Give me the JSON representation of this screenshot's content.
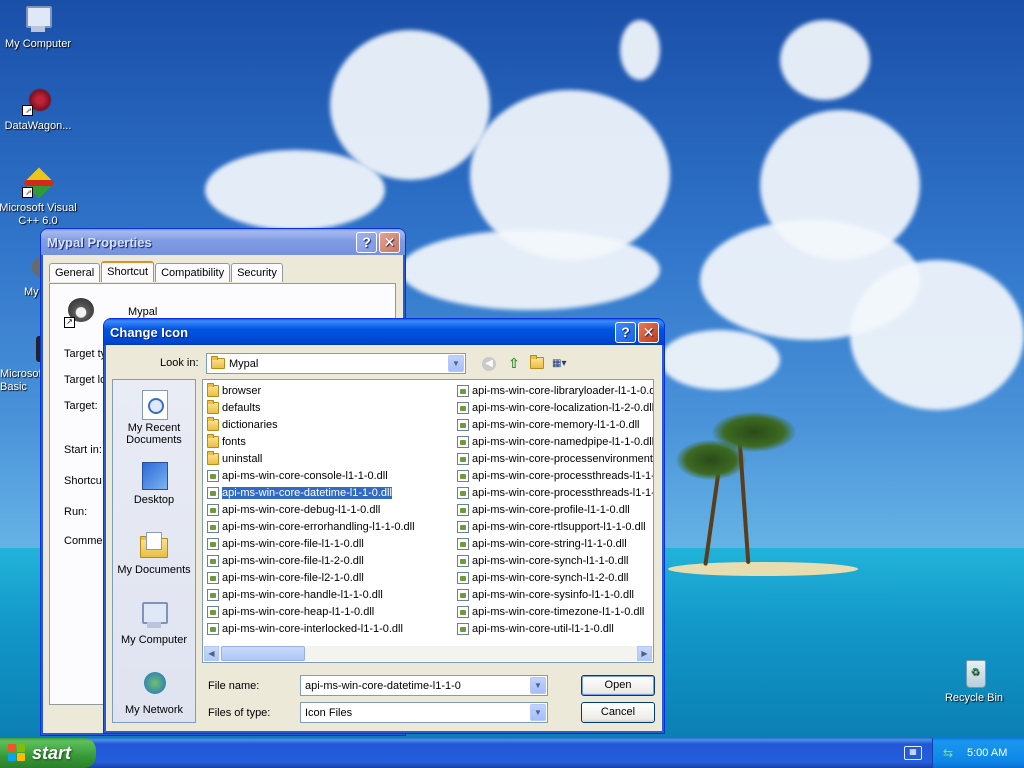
{
  "desktop": {
    "icons": [
      {
        "label": "My Computer"
      },
      {
        "label": "DataWagon..."
      },
      {
        "label": "Microsoft Visual C++ 6.0"
      },
      {
        "label": "My"
      },
      {
        "label": "Microsoft Basic"
      },
      {
        "label": "Recycle Bin"
      }
    ]
  },
  "props_window": {
    "title": "Mypal Properties",
    "tabs": [
      "General",
      "Shortcut",
      "Compatibility",
      "Security"
    ],
    "app_name": "Mypal",
    "labels": [
      "Target ty",
      "Target lo",
      "Target:",
      "Start in:",
      "Shortcu",
      "Run:",
      "Commer"
    ]
  },
  "change_icon": {
    "title": "Change Icon",
    "look_in_label": "Look in:",
    "look_in_value": "Mypal",
    "places": [
      "My Recent Documents",
      "Desktop",
      "My Documents",
      "My Computer",
      "My Network"
    ],
    "files_col1": [
      {
        "name": "browser",
        "type": "folder"
      },
      {
        "name": "defaults",
        "type": "folder"
      },
      {
        "name": "dictionaries",
        "type": "folder"
      },
      {
        "name": "fonts",
        "type": "folder"
      },
      {
        "name": "uninstall",
        "type": "folder"
      },
      {
        "name": "api-ms-win-core-console-l1-1-0.dll",
        "type": "dll"
      },
      {
        "name": "api-ms-win-core-datetime-l1-1-0.dll",
        "type": "dll",
        "selected": true
      },
      {
        "name": "api-ms-win-core-debug-l1-1-0.dll",
        "type": "dll"
      },
      {
        "name": "api-ms-win-core-errorhandling-l1-1-0.dll",
        "type": "dll"
      },
      {
        "name": "api-ms-win-core-file-l1-1-0.dll",
        "type": "dll"
      },
      {
        "name": "api-ms-win-core-file-l1-2-0.dll",
        "type": "dll"
      },
      {
        "name": "api-ms-win-core-file-l2-1-0.dll",
        "type": "dll"
      },
      {
        "name": "api-ms-win-core-handle-l1-1-0.dll",
        "type": "dll"
      },
      {
        "name": "api-ms-win-core-heap-l1-1-0.dll",
        "type": "dll"
      },
      {
        "name": "api-ms-win-core-interlocked-l1-1-0.dll",
        "type": "dll"
      }
    ],
    "files_col2": [
      {
        "name": "api-ms-win-core-libraryloader-l1-1-0.d",
        "type": "dll"
      },
      {
        "name": "api-ms-win-core-localization-l1-2-0.dll",
        "type": "dll"
      },
      {
        "name": "api-ms-win-core-memory-l1-1-0.dll",
        "type": "dll"
      },
      {
        "name": "api-ms-win-core-namedpipe-l1-1-0.dll",
        "type": "dll"
      },
      {
        "name": "api-ms-win-core-processenvironment",
        "type": "dll"
      },
      {
        "name": "api-ms-win-core-processthreads-l1-1-",
        "type": "dll"
      },
      {
        "name": "api-ms-win-core-processthreads-l1-1-",
        "type": "dll"
      },
      {
        "name": "api-ms-win-core-profile-l1-1-0.dll",
        "type": "dll"
      },
      {
        "name": "api-ms-win-core-rtlsupport-l1-1-0.dll",
        "type": "dll"
      },
      {
        "name": "api-ms-win-core-string-l1-1-0.dll",
        "type": "dll"
      },
      {
        "name": "api-ms-win-core-synch-l1-1-0.dll",
        "type": "dll"
      },
      {
        "name": "api-ms-win-core-synch-l1-2-0.dll",
        "type": "dll"
      },
      {
        "name": "api-ms-win-core-sysinfo-l1-1-0.dll",
        "type": "dll"
      },
      {
        "name": "api-ms-win-core-timezone-l1-1-0.dll",
        "type": "dll"
      },
      {
        "name": "api-ms-win-core-util-l1-1-0.dll",
        "type": "dll"
      }
    ],
    "file_name_label": "File name:",
    "file_name_value": "api-ms-win-core-datetime-l1-1-0",
    "file_type_label": "Files of type:",
    "file_type_value": "Icon Files",
    "open_label": "Open",
    "cancel_label": "Cancel"
  },
  "taskbar": {
    "start_label": "start",
    "clock": "5:00 AM"
  }
}
